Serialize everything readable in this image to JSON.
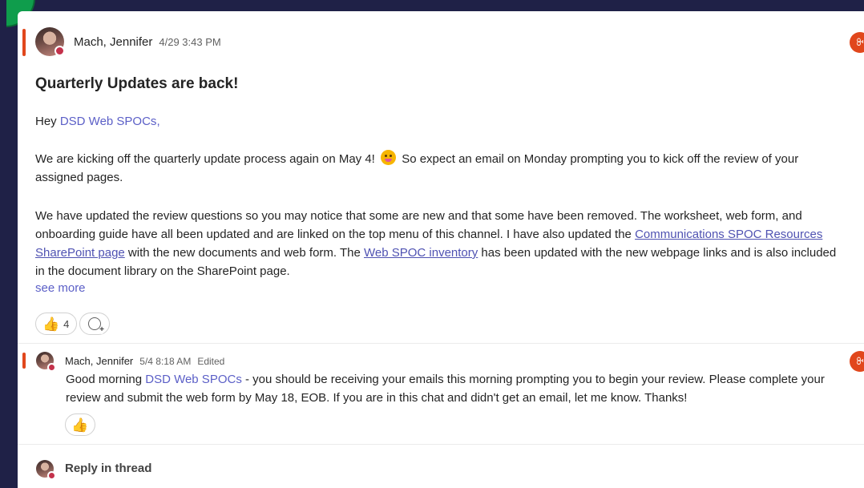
{
  "post": {
    "author": "Mach, Jennifer",
    "timestamp": "4/29 3:43 PM",
    "subject": "Quarterly Updates are back!",
    "greeting_prefix": "Hey ",
    "mention": "DSD Web SPOCs",
    "greeting_suffix": ",",
    "p1_before": "We are kicking off the quarterly update process again on May 4!",
    "p1_after": " So expect an email on Monday prompting you to kick off the review of your assigned pages.",
    "p2_part1": "We have updated the review questions so you may notice that some are new and that some have been removed. The worksheet, web form, and onboarding guide have all been updated and are linked on the top menu of this channel. I have also updated the ",
    "p2_link1": "Communications SPOC Resources SharePoint page",
    "p2_part2": " with the new documents and web form. The ",
    "p2_link2": "Web SPOC inventory",
    "p2_part3": " has been updated with the new webpage links and is also included in the document library on the SharePoint page.",
    "see_more": "see more",
    "like_count": "4"
  },
  "reply": {
    "author": "Mach, Jennifer",
    "timestamp": "5/4 8:18 AM",
    "edited": "Edited",
    "prefix": "Good morning ",
    "mention": "DSD Web SPOCs",
    "body": " - you should be receiving your emails this morning prompting you to begin your review. Please complete your review and submit the web form by May 18, EOB. If you are in this chat and didn't get an email, let me know. Thanks!"
  },
  "reply_in_thread": "Reply in thread",
  "icons": {
    "thumbs_up": "👍",
    "add_reaction": "add-reaction-icon",
    "loop": "ꔬ"
  },
  "colors": {
    "accent": "#e1471c",
    "mention": "#5b5fc7",
    "background": "#1f2147"
  }
}
